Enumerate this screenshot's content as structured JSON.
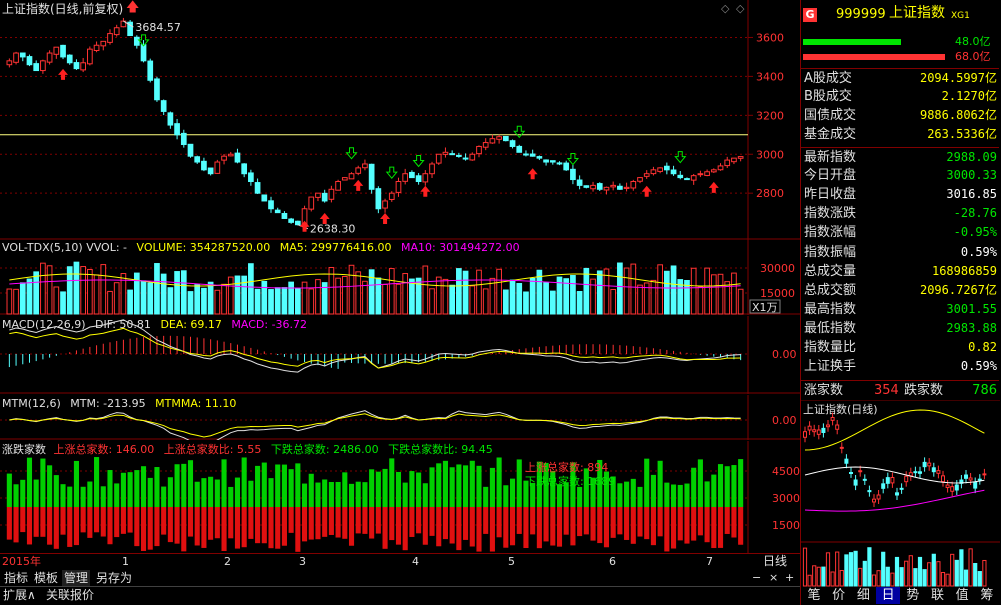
{
  "chart_title": "上证指数(日线,前复权)",
  "main": {
    "high_label": "3684.57",
    "low_label": "2638.30",
    "ticks": [
      "3600",
      "3400",
      "3200",
      "3000",
      "2800"
    ],
    "tick_values": [
      3600,
      3400,
      3200,
      3000,
      2800
    ],
    "ref_line": 3100
  },
  "vol": {
    "name": "VOL-TDX(5,10)",
    "vol_label": "VVOL: -",
    "volume": "VOLUME: 354287520.00",
    "ma5": "MA5: 299776416.00",
    "ma10": "MA10: 301494272.00",
    "ticks": [
      "30000",
      "15000"
    ],
    "unit": "X1万"
  },
  "macd": {
    "name": "MACD(12,26,9)",
    "dif": "DIF: 50.81",
    "dea": "DEA: 69.17",
    "macd": "MACD: -36.72",
    "tick": "0.00"
  },
  "mtm": {
    "name": "MTM(12,6)",
    "mtm": "MTM: -213.95",
    "mtmma": "MTMMA: 11.10",
    "tick": "0.00"
  },
  "adl": {
    "name": "涨跌家数",
    "up_total": "上涨总家数: 146.00",
    "up_ratio": "上涨总家数比: 5.55",
    "down_total": "下跌总家数: 2486.00",
    "down_ratio": "下跌总家数比: 94.45",
    "ticks": [
      "4500",
      "3000",
      "1500"
    ],
    "overlay1": "上涨总家数: 894",
    "overlay2": "下跌总家数: 1689"
  },
  "xaxis": {
    "year": "2015年",
    "months": [
      "1",
      "2",
      "3",
      "4",
      "5",
      "6",
      "7"
    ],
    "period": "日线"
  },
  "bottom_tabs": [
    "指标",
    "模板",
    "管理",
    "另存为"
  ],
  "status_tabs": [
    "扩展∧",
    "关联报价"
  ],
  "right_panel": {
    "badge": "G",
    "code": "999999",
    "name": "上证指数",
    "suffix": "XG1",
    "bar1": "48.0亿",
    "bar2": "68.0亿",
    "bar1_ratio": 0.41,
    "bar2_ratio": 0.59,
    "rows_a": [
      {
        "k": "A股成交",
        "v": "2094.5997亿"
      },
      {
        "k": "B股成交",
        "v": "2.1270亿"
      },
      {
        "k": "国债成交",
        "v": "9886.8062亿"
      },
      {
        "k": "基金成交",
        "v": "263.5336亿"
      }
    ],
    "rows_b": [
      {
        "k": "最新指数",
        "v": "2988.09",
        "c": "#00e600"
      },
      {
        "k": "今日开盘",
        "v": "3000.33",
        "c": "#00e600"
      },
      {
        "k": "昨日收盘",
        "v": "3016.85",
        "c": "#ffffff"
      },
      {
        "k": "指数涨跌",
        "v": "-28.76",
        "c": "#00e600"
      },
      {
        "k": "指数涨幅",
        "v": "-0.95%",
        "c": "#00e600"
      },
      {
        "k": "指数振幅",
        "v": "0.59%",
        "c": "#ffffff"
      },
      {
        "k": "总成交量",
        "v": "168986859",
        "c": "#ffff00"
      },
      {
        "k": "总成交额",
        "v": "2096.7267亿",
        "c": "#ffff00"
      },
      {
        "k": "最高指数",
        "v": "3001.55",
        "c": "#00e600"
      },
      {
        "k": "最低指数",
        "v": "2983.88",
        "c": "#00e600"
      },
      {
        "k": "指数量比",
        "v": "0.82",
        "c": "#ffff00"
      },
      {
        "k": "上证换手",
        "v": "0.59%",
        "c": "#ffffff"
      }
    ],
    "updown": {
      "up_label": "涨家数",
      "up": "354",
      "down_label": "跌家数",
      "down": "786"
    },
    "mini_title": "上证指数(日线)",
    "mini_ticks": [
      "4500",
      "3000",
      "1500"
    ],
    "bottom_tabs": [
      "笔",
      "价",
      "细",
      "日",
      "势",
      "联",
      "值",
      "筹"
    ]
  },
  "colors": {
    "up": "#ff3333",
    "down": "#54ffff",
    "grid": "#800000",
    "yellow": "#ffff00",
    "magenta": "#ff00ff",
    "green": "#00e600"
  },
  "chart_data": {
    "type": "candlestick",
    "title": "上证指数(日线,前复权)",
    "yrange": [
      2580,
      3700
    ],
    "annotations": [
      {
        "label": "3684.57"
      },
      {
        "label": "2638.30"
      }
    ],
    "candles_close": [
      3480,
      3520,
      3500,
      3460,
      3430,
      3480,
      3520,
      3550,
      3500,
      3470,
      3440,
      3470,
      3540,
      3560,
      3580,
      3620,
      3650,
      3684,
      3610,
      3560,
      3480,
      3380,
      3280,
      3220,
      3150,
      3100,
      3050,
      2990,
      2960,
      2920,
      2900,
      2960,
      2990,
      3000,
      2960,
      2900,
      2860,
      2800,
      2760,
      2720,
      2700,
      2670,
      2650,
      2638,
      2720,
      2780,
      2800,
      2760,
      2820,
      2860,
      2880,
      2900,
      2930,
      2950,
      2820,
      2720,
      2760,
      2800,
      2860,
      2900,
      2880,
      2860,
      2900,
      2950,
      3000,
      3010,
      3000,
      2990,
      2980,
      3000,
      3040,
      3060,
      3080,
      3090,
      3070,
      3040,
      3010,
      3000,
      2990,
      2980,
      2960,
      2960,
      2950,
      2920,
      2870,
      2840,
      2830,
      2840,
      2820,
      2830,
      2840,
      2820,
      2830,
      2860,
      2880,
      2900,
      2920,
      2930,
      2920,
      2900,
      2880,
      2870,
      2890,
      2900,
      2910,
      2920,
      2940,
      2970,
      2980,
      2988
    ]
  }
}
